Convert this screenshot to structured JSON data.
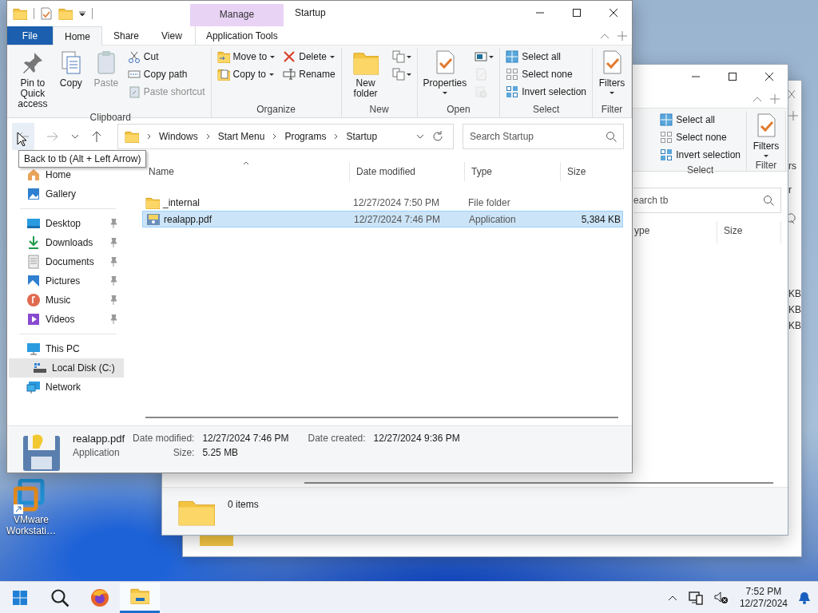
{
  "desktop_icons": [
    {
      "label": "VMware Workstati…"
    }
  ],
  "far_window": {
    "fragments": [
      "rs",
      "r"
    ],
    "sizes": [
      "KB",
      "KB",
      "KB"
    ]
  },
  "behind_window": {
    "ribbon": [
      {
        "label": "Select",
        "items": [
          {
            "kind": "stack",
            "items": [
              {
                "label": "Select all",
                "disabled": false
              },
              {
                "label": "Select none",
                "disabled": false
              },
              {
                "label": "Invert selection",
                "disabled": false
              }
            ]
          }
        ]
      },
      {
        "label": "Filter",
        "items": [
          {
            "kind": "large",
            "label": "Filters",
            "dropdown": true,
            "disabled": false
          }
        ]
      }
    ],
    "search": {
      "placeholder": "earch tb"
    },
    "columns": [
      "ype",
      "Size"
    ],
    "status": "0 items"
  },
  "main_window": {
    "title": "Startup",
    "context_header": "Manage",
    "tabs": [
      {
        "label": "File",
        "kind": "file",
        "selected": false
      },
      {
        "label": "Home",
        "kind": "tab",
        "selected": true
      },
      {
        "label": "Share",
        "kind": "tab",
        "selected": false
      },
      {
        "label": "View",
        "kind": "tab",
        "selected": false
      },
      {
        "label": "Application Tools",
        "kind": "context",
        "selected": false
      }
    ],
    "ribbon": [
      {
        "label": "Clipboard",
        "items": [
          {
            "kind": "large",
            "label": "Pin to Quick access",
            "dropdown": false,
            "disabled": false
          },
          {
            "kind": "large",
            "label": "Copy",
            "dropdown": false,
            "disabled": false
          },
          {
            "kind": "large",
            "label": "Paste",
            "dropdown": false,
            "disabled": true
          },
          {
            "kind": "stack",
            "items": [
              {
                "label": "Cut",
                "disabled": false
              },
              {
                "label": "Copy path",
                "disabled": false
              },
              {
                "label": "Paste shortcut",
                "disabled": true
              }
            ]
          }
        ]
      },
      {
        "label": "Organize",
        "items": [
          {
            "kind": "stack",
            "items": [
              {
                "label": "Move to",
                "dropdown": true,
                "disabled": false
              },
              {
                "label": "Copy to",
                "dropdown": true,
                "disabled": false
              }
            ]
          },
          {
            "kind": "stack",
            "items": [
              {
                "label": "Delete",
                "dropdown": true,
                "disabled": false
              },
              {
                "label": "Rename",
                "disabled": false
              }
            ]
          }
        ]
      },
      {
        "label": "New",
        "items": [
          {
            "kind": "large",
            "label": "New folder",
            "dropdown": false,
            "disabled": false
          },
          {
            "kind": "icons",
            "items": [
              {
                "dropdown": true,
                "disabled": false
              },
              {
                "dropdown": true,
                "disabled": false
              }
            ]
          }
        ]
      },
      {
        "label": "Open",
        "items": [
          {
            "kind": "large",
            "label": "Properties",
            "dropdown": true,
            "disabled": false
          },
          {
            "kind": "icons",
            "items": [
              {
                "dropdown": true,
                "disabled": false
              },
              {
                "dropdown": false,
                "disabled": true
              },
              {
                "dropdown": false,
                "disabled": true
              }
            ]
          }
        ]
      },
      {
        "label": "Select",
        "items": [
          {
            "kind": "stack",
            "items": [
              {
                "label": "Select all",
                "disabled": false
              },
              {
                "label": "Select none",
                "disabled": false
              },
              {
                "label": "Invert selection",
                "disabled": false
              }
            ]
          }
        ]
      },
      {
        "label": "Filter",
        "items": [
          {
            "kind": "large",
            "label": "Filters",
            "dropdown": true,
            "disabled": false
          }
        ]
      }
    ],
    "crumbs": [
      "Windows",
      "Start Menu",
      "Programs",
      "Startup"
    ],
    "search": {
      "placeholder": "Search Startup"
    },
    "tooltip": "Back to tb (Alt + Left Arrow)",
    "nav_pane": [
      {
        "items": [
          {
            "label": "Home",
            "pinned": false,
            "selected": false
          },
          {
            "label": "Gallery",
            "pinned": false,
            "selected": false
          }
        ]
      },
      {
        "items": [
          {
            "label": "Desktop",
            "pinned": true,
            "selected": false
          },
          {
            "label": "Downloads",
            "pinned": true,
            "selected": false
          },
          {
            "label": "Documents",
            "pinned": true,
            "selected": false
          },
          {
            "label": "Pictures",
            "pinned": true,
            "selected": false
          },
          {
            "label": "Music",
            "pinned": true,
            "selected": false
          },
          {
            "label": "Videos",
            "pinned": true,
            "selected": false
          }
        ]
      },
      {
        "items": [
          {
            "label": "This PC",
            "pinned": false,
            "selected": false,
            "children": [
              {
                "label": "Local Disk (C:)",
                "pinned": false,
                "selected": true
              }
            ]
          },
          {
            "label": "Network",
            "pinned": false,
            "selected": false
          }
        ]
      }
    ],
    "columns": [
      {
        "label": "Name",
        "sorted": true
      },
      {
        "label": "Date modified",
        "sorted": false
      },
      {
        "label": "Type",
        "sorted": false
      },
      {
        "label": "Size",
        "sorted": false
      }
    ],
    "files": [
      {
        "kind": "folder",
        "name": "_internal",
        "date": "12/27/2024 7:50 PM",
        "type": "File folder",
        "selected": false
      },
      {
        "kind": "app",
        "name": "realapp.pdf",
        "date": "12/27/2024 7:46 PM",
        "type": "Application",
        "size": "5,384 KB",
        "selected": true
      }
    ],
    "details": {
      "name": "realapp.pdf",
      "type": "Application",
      "fields": [
        {
          "label": "Date modified:",
          "value": "12/27/2024 7:46 PM"
        },
        {
          "label": "Size:",
          "value": "5.25 MB"
        },
        {
          "label": "Date created:",
          "value": "12/27/2024 9:36 PM"
        }
      ]
    }
  },
  "taskbar": {
    "apps": [
      {
        "active": false
      },
      {
        "active": false
      },
      {
        "active": false
      },
      {
        "active": true
      }
    ],
    "time": "7:52 PM",
    "date": "12/27/2024"
  }
}
